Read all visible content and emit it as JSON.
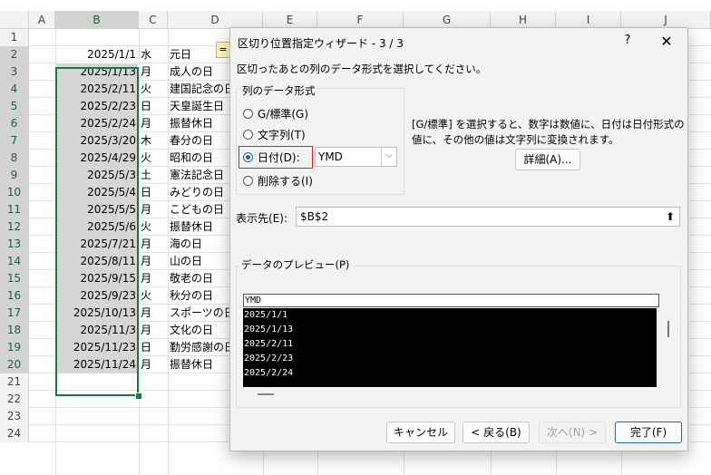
{
  "spreadsheet": {
    "columns": [
      "A",
      "B",
      "C",
      "D",
      "E",
      "F",
      "G",
      "H",
      "I",
      "J"
    ],
    "selected_column": "B",
    "selected_rows": "2-20",
    "row_numbers": [
      "1",
      "2",
      "3",
      "4",
      "5",
      "6",
      "7",
      "8",
      "9",
      "10",
      "11",
      "12",
      "13",
      "14",
      "15",
      "16",
      "17",
      "18",
      "19",
      "20",
      "21",
      "22",
      "23",
      "24"
    ],
    "formula_chip": "=",
    "rows": [
      {
        "date": "2025/1/1",
        "weekday": "水",
        "holiday": "元日"
      },
      {
        "date": "2025/1/13",
        "weekday": "月",
        "holiday": "成人の日"
      },
      {
        "date": "2025/2/11",
        "weekday": "火",
        "holiday": "建国記念の日"
      },
      {
        "date": "2025/2/23",
        "weekday": "日",
        "holiday": "天皇誕生日"
      },
      {
        "date": "2025/2/24",
        "weekday": "月",
        "holiday": "振替休日"
      },
      {
        "date": "2025/3/20",
        "weekday": "木",
        "holiday": "春分の日"
      },
      {
        "date": "2025/4/29",
        "weekday": "火",
        "holiday": "昭和の日"
      },
      {
        "date": "2025/5/3",
        "weekday": "土",
        "holiday": "憲法記念日"
      },
      {
        "date": "2025/5/4",
        "weekday": "日",
        "holiday": "みどりの日"
      },
      {
        "date": "2025/5/5",
        "weekday": "月",
        "holiday": "こどもの日"
      },
      {
        "date": "2025/5/6",
        "weekday": "火",
        "holiday": "振替休日"
      },
      {
        "date": "2025/7/21",
        "weekday": "月",
        "holiday": "海の日"
      },
      {
        "date": "2025/8/11",
        "weekday": "月",
        "holiday": "山の日"
      },
      {
        "date": "2025/9/15",
        "weekday": "月",
        "holiday": "敬老の日"
      },
      {
        "date": "2025/9/23",
        "weekday": "火",
        "holiday": "秋分の日"
      },
      {
        "date": "2025/10/13",
        "weekday": "月",
        "holiday": "スポーツの日"
      },
      {
        "date": "2025/11/3",
        "weekday": "月",
        "holiday": "文化の日"
      },
      {
        "date": "2025/11/23",
        "weekday": "日",
        "holiday": "勤労感謝の日"
      },
      {
        "date": "2025/11/24",
        "weekday": "月",
        "holiday": "振替休日"
      }
    ]
  },
  "dialog": {
    "title": "区切り位置指定ウィザード - 3 / 3",
    "help": "?",
    "close": "✕",
    "instruction": "区切ったあとの列のデータ形式を選択してください。",
    "format_group_label": "列のデータ形式",
    "options": [
      {
        "label": "G/標準(G)",
        "selected": false
      },
      {
        "label": "文字列(T)",
        "selected": false
      },
      {
        "label": "日付(D):",
        "selected": true
      },
      {
        "label": "削除する(I)",
        "selected": false
      }
    ],
    "date_format_value": "YMD",
    "description_line1": "[G/標準] を選択すると、数字は数値に、日付は日付形式の",
    "description_line2": "値に、その他の値は文字列に変換されます。",
    "detail_button": "詳細(A)...",
    "destination_label": "表示先(E):",
    "destination_value": "$B$2",
    "preview_label": "データのプレビュー(P)",
    "preview_header": "YMD",
    "preview_rows": [
      "2025/1/1",
      "2025/1/13",
      "2025/2/11",
      "2025/2/23",
      "2025/2/24"
    ],
    "buttons": {
      "cancel": "キャンセル",
      "back": "< 戻る(B)",
      "next": "次へ(N) >",
      "finish": "完了(F)"
    }
  },
  "colors": {
    "selection_green": "#107c41",
    "highlight_red": "#e02020",
    "preview_bg": "#000000"
  }
}
